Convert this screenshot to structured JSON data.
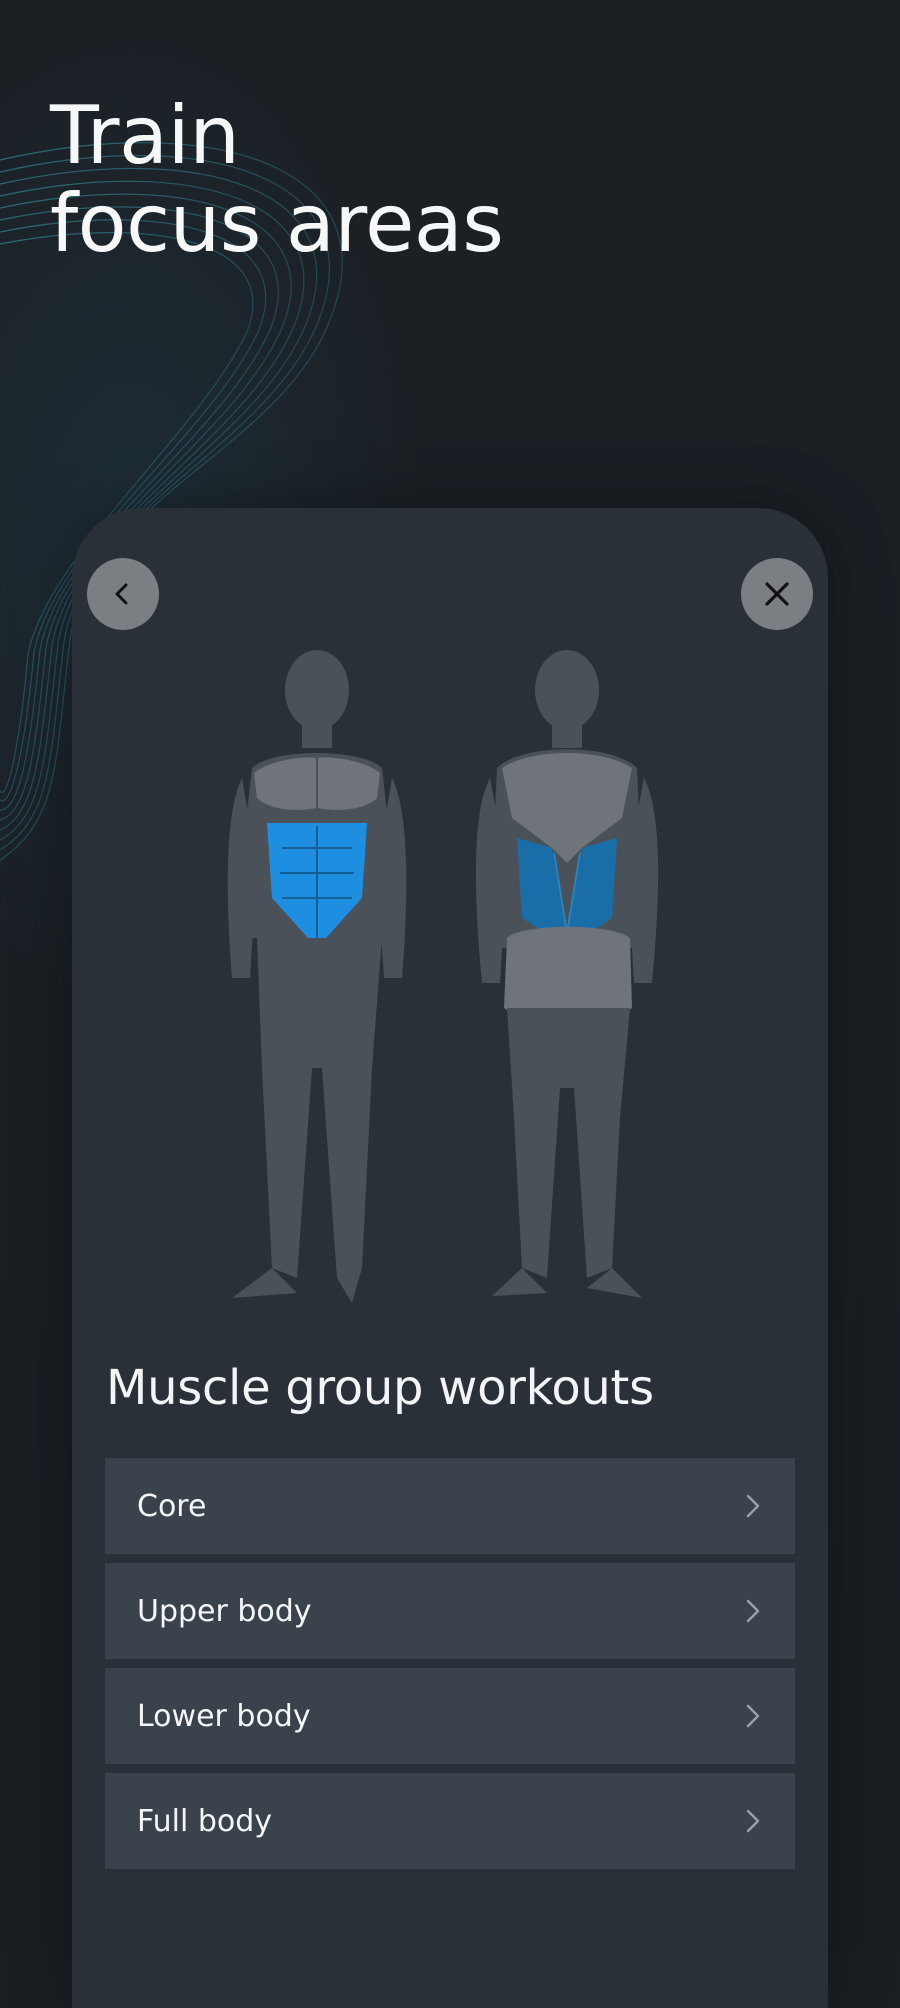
{
  "headline": {
    "line1": "Train",
    "line2": "focus areas"
  },
  "card": {
    "back_icon": "chevron-left-icon",
    "close_icon": "close-icon",
    "section_title": "Muscle group workouts",
    "items": [
      {
        "label": "Core",
        "icon": "chevron-right-icon"
      },
      {
        "label": "Upper body",
        "icon": "chevron-right-icon"
      },
      {
        "label": "Lower body",
        "icon": "chevron-right-icon"
      },
      {
        "label": "Full body",
        "icon": "chevron-right-icon"
      }
    ]
  },
  "colors": {
    "background": "#1a1f24",
    "card": "#2a3038",
    "list_item": "#3a434c",
    "highlight_front": "#1e8fe0",
    "highlight_back": "#1a6ea8",
    "body_base": "#4a5158",
    "body_light": "#6e747a",
    "swirl": "#3fa6b8"
  },
  "highlighted_muscle_group": "Core"
}
